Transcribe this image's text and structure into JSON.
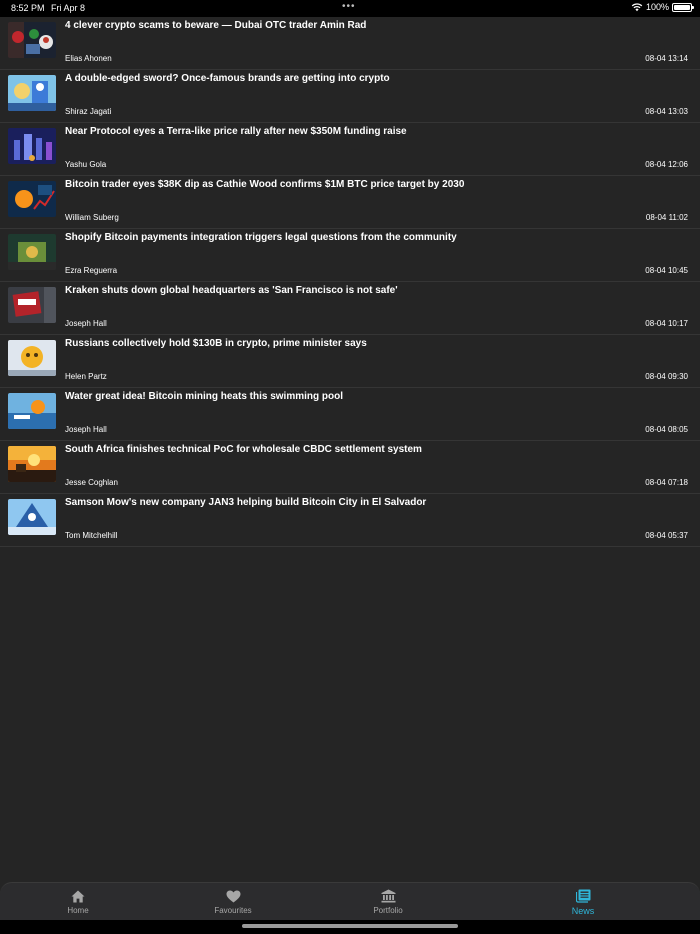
{
  "status_bar": {
    "time": "8:52 PM",
    "date": "Fri Apr 8",
    "dots": "•••",
    "battery": "100%",
    "battery_level": 1.0
  },
  "articles": [
    {
      "title": "4 clever crypto scams to beware — Dubai OTC trader Amin Rad",
      "author": "Elias Ahonen",
      "time": "08-04 13:14"
    },
    {
      "title": "A double-edged sword? Once-famous brands are getting into crypto",
      "author": "Shiraz Jagati",
      "time": "08-04 13:03"
    },
    {
      "title": "Near Protocol eyes a Terra-like price rally after new $350M funding raise",
      "author": "Yashu Gola",
      "time": "08-04 12:06"
    },
    {
      "title": "Bitcoin trader eyes $38K dip as Cathie Wood confirms $1M BTC price target by 2030",
      "author": "William Suberg",
      "time": "08-04 11:02"
    },
    {
      "title": "Shopify Bitcoin payments integration triggers legal questions from the community",
      "author": "Ezra Reguerra",
      "time": "08-04 10:45"
    },
    {
      "title": "Kraken shuts down global headquarters as 'San Francisco is not safe'",
      "author": "Joseph Hall",
      "time": "08-04 10:17"
    },
    {
      "title": "Russians collectively hold $130B in crypto, prime minister says",
      "author": "Helen Partz",
      "time": "08-04 09:30"
    },
    {
      "title": "Water great idea! Bitcoin mining heats this swimming pool",
      "author": "Joseph Hall",
      "time": "08-04 08:05"
    },
    {
      "title": "South Africa finishes technical PoC for wholesale CBDC settlement system",
      "author": "Jesse Coghlan",
      "time": "08-04 07:18"
    },
    {
      "title": "Samson Mow's new company JAN3 helping build Bitcoin City in El Salvador",
      "author": "Tom Mitchelhill",
      "time": "08-04 05:37"
    }
  ],
  "tabs": [
    {
      "label": "Home",
      "icon": "home-icon"
    },
    {
      "label": "Favourites",
      "icon": "heart-icon"
    },
    {
      "label": "Portfolio",
      "icon": "bank-icon"
    },
    {
      "label": "News",
      "icon": "newspaper-icon",
      "active": true
    }
  ],
  "colors": {
    "background": "#252525",
    "accent": "#2fb6d9",
    "tab_inactive": "#a7a7a7"
  }
}
